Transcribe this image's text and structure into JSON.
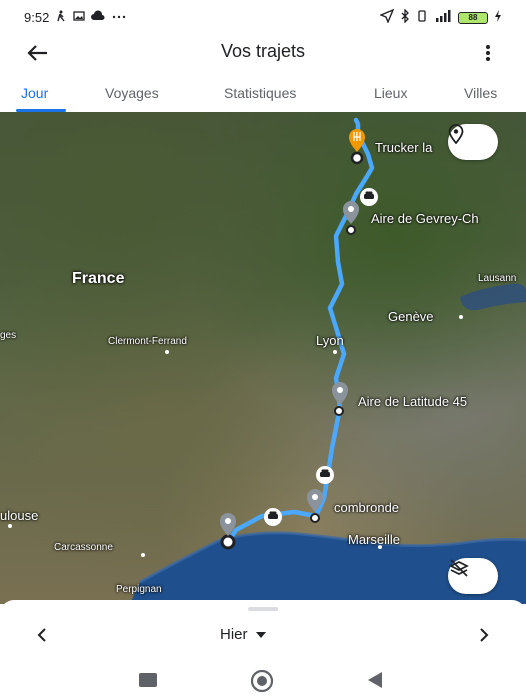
{
  "status_bar": {
    "time": "9:52",
    "battery_level": "88"
  },
  "header": {
    "title": "Vos trajets"
  },
  "tabs": [
    {
      "label": "Jour",
      "active": true
    },
    {
      "label": "Voyages",
      "active": false
    },
    {
      "label": "Statistiques",
      "active": false
    },
    {
      "label": "Lieux",
      "active": false
    },
    {
      "label": "Villes",
      "active": false
    }
  ],
  "map": {
    "labels": {
      "france": "France",
      "trucker": "Trucker la",
      "gevrey": "Aire de Gevrey-Ch",
      "lausanne": "Lausann",
      "geneve": "Genève",
      "clermont": "Clermont-Ferrand",
      "lyon": "Lyon",
      "latitude": "Aire de Latitude 45",
      "combronde": "combronde",
      "marseille": "Marseille",
      "toulouse": "ulouse",
      "carcassonne": "Carcassonne",
      "perpignan": "Perpignan",
      "edge_left": "ges"
    },
    "route_color": "#4aa8ff",
    "icons": {
      "restaurant_pin": "restaurant-pin-icon",
      "place_pin": "place-pin-icon",
      "car": "car-icon"
    }
  },
  "bottom": {
    "day_label": "Hier"
  }
}
